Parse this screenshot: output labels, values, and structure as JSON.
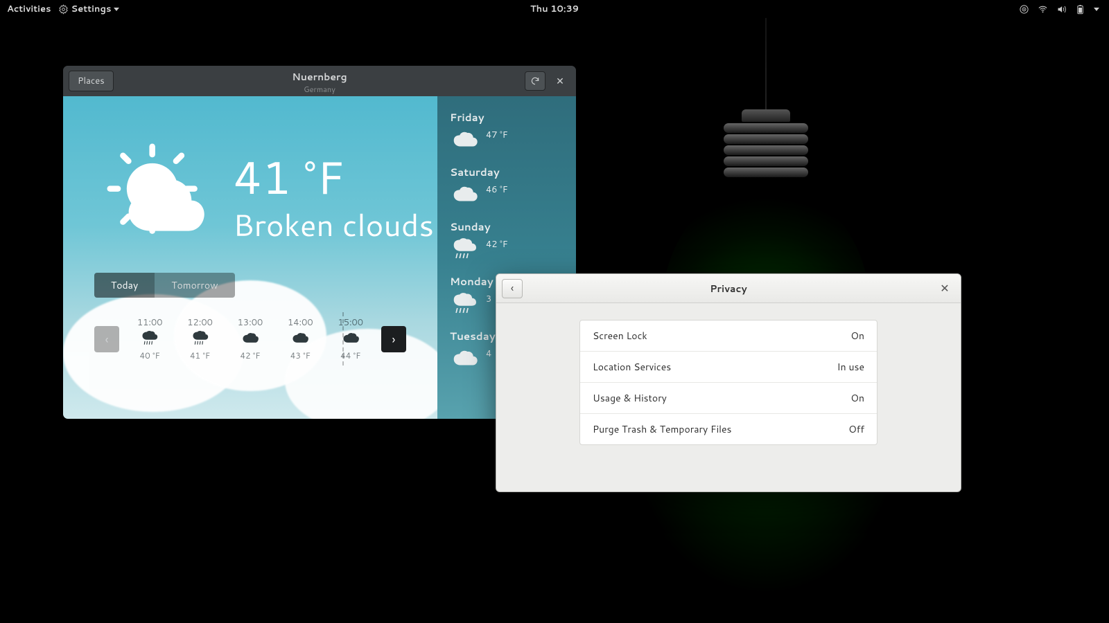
{
  "topbar": {
    "activities": "Activities",
    "app_menu": "Settings",
    "clock": "Thu 10:39"
  },
  "weather": {
    "places_label": "Places",
    "title_city": "Nuernberg",
    "title_country": "Germany",
    "current_temp": "41 °F",
    "current_condition": "Broken clouds",
    "tabs": {
      "today": "Today",
      "tomorrow": "Tomorrow"
    },
    "hours": [
      {
        "time": "11:00",
        "temp": "40 °F",
        "icon": "rain"
      },
      {
        "time": "12:00",
        "temp": "41 °F",
        "icon": "rain"
      },
      {
        "time": "13:00",
        "temp": "42 °F",
        "icon": "cloud"
      },
      {
        "time": "14:00",
        "temp": "43 °F",
        "icon": "cloud"
      },
      {
        "time": "15:00",
        "temp": "44 °F",
        "icon": "cloud"
      }
    ],
    "forecast": [
      {
        "day": "Friday",
        "temp": "47 °F",
        "icon": "cloud"
      },
      {
        "day": "Saturday",
        "temp": "46 °F",
        "icon": "cloud"
      },
      {
        "day": "Sunday",
        "temp": "42 °F",
        "icon": "rain"
      },
      {
        "day": "Monday",
        "temp": "3",
        "icon": "rain"
      },
      {
        "day": "Tuesday",
        "temp": "4",
        "icon": "cloud"
      }
    ]
  },
  "privacy": {
    "title": "Privacy",
    "rows": [
      {
        "label": "Screen Lock",
        "value": "On"
      },
      {
        "label": "Location Services",
        "value": "In use"
      },
      {
        "label": "Usage & History",
        "value": "On"
      },
      {
        "label": "Purge Trash & Temporary Files",
        "value": "Off"
      }
    ]
  }
}
